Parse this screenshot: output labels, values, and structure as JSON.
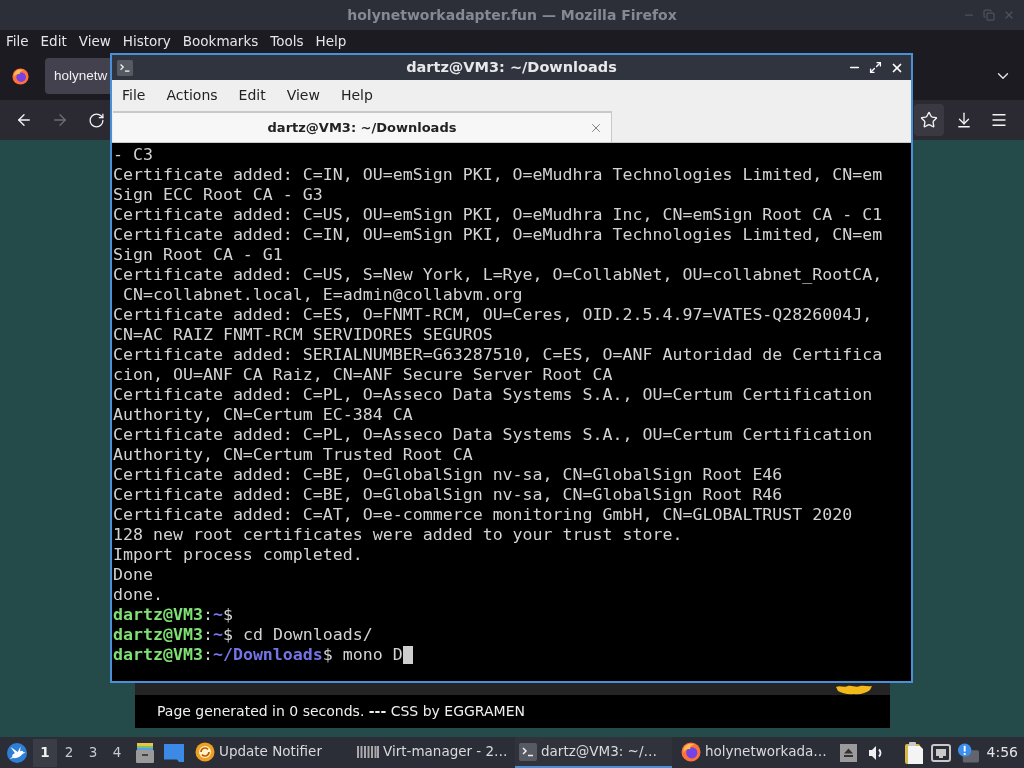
{
  "firefox": {
    "title": "holynetworkadapter.fun — Mozilla Firefox",
    "menu": [
      "File",
      "Edit",
      "View",
      "History",
      "Bookmarks",
      "Tools",
      "Help"
    ],
    "tabs": [
      {
        "label": "holynetw",
        "selected": true
      }
    ],
    "nav_buttons": [
      {
        "kind": "back",
        "disabled": false
      },
      {
        "kind": "forward",
        "disabled": true
      },
      {
        "kind": "reload",
        "disabled": false
      }
    ],
    "toolbar_buttons": [
      {
        "kind": "bookmark",
        "highlighted": true
      },
      {
        "kind": "downloads",
        "highlighted": false
      },
      {
        "kind": "menu",
        "highlighted": false
      }
    ],
    "page": {
      "footer": "Page generated in 0 seconds. **---** CSS by EGGRAMEN"
    }
  },
  "terminal": {
    "title": "dartz@VM3: ~/Downloads",
    "menu": [
      "File",
      "Actions",
      "Edit",
      "View",
      "Help"
    ],
    "tabs": [
      {
        "label": "dartz@VM3: ~/Downloads",
        "selected": true
      }
    ],
    "lines": [
      {
        "kind": "output",
        "text": "- C3"
      },
      {
        "kind": "output",
        "text": "Certificate added: C=IN, OU=emSign PKI, O=eMudhra Technologies Limited, CN=em"
      },
      {
        "kind": "output",
        "text": "Sign ECC Root CA - G3"
      },
      {
        "kind": "output",
        "text": "Certificate added: C=US, OU=emSign PKI, O=eMudhra Inc, CN=emSign Root CA - C1"
      },
      {
        "kind": "output",
        "text": "Certificate added: C=IN, OU=emSign PKI, O=eMudhra Technologies Limited, CN=em"
      },
      {
        "kind": "output",
        "text": "Sign Root CA - G1"
      },
      {
        "kind": "output",
        "text": "Certificate added: C=US, S=New York, L=Rye, O=CollabNet, OU=collabnet_RootCA,"
      },
      {
        "kind": "output",
        "text": " CN=collabnet.local, E=admin@collabvm.org"
      },
      {
        "kind": "output",
        "text": "Certificate added: C=ES, O=FNMT-RCM, OU=Ceres, OID.2.5.4.97=VATES-Q2826004J,"
      },
      {
        "kind": "output",
        "text": "CN=AC RAIZ FNMT-RCM SERVIDORES SEGUROS"
      },
      {
        "kind": "output",
        "text": "Certificate added: SERIALNUMBER=G63287510, C=ES, O=ANF Autoridad de Certifica"
      },
      {
        "kind": "output",
        "text": "cion, OU=ANF CA Raiz, CN=ANF Secure Server Root CA"
      },
      {
        "kind": "output",
        "text": "Certificate added: C=PL, O=Asseco Data Systems S.A., OU=Certum Certification"
      },
      {
        "kind": "output",
        "text": "Authority, CN=Certum EC-384 CA"
      },
      {
        "kind": "output",
        "text": "Certificate added: C=PL, O=Asseco Data Systems S.A., OU=Certum Certification"
      },
      {
        "kind": "output",
        "text": "Authority, CN=Certum Trusted Root CA"
      },
      {
        "kind": "output",
        "text": "Certificate added: C=BE, O=GlobalSign nv-sa, CN=GlobalSign Root E46"
      },
      {
        "kind": "output",
        "text": "Certificate added: C=BE, O=GlobalSign nv-sa, CN=GlobalSign Root R46"
      },
      {
        "kind": "output",
        "text": "Certificate added: C=AT, O=e-commerce monitoring GmbH, CN=GLOBALTRUST 2020"
      },
      {
        "kind": "output",
        "text": "128 new root certificates were added to your trust store."
      },
      {
        "kind": "output",
        "text": "Import process completed."
      },
      {
        "kind": "output",
        "text": "Done"
      },
      {
        "kind": "output",
        "text": "done."
      },
      {
        "kind": "prompt",
        "user": "dartz@VM3",
        "colon": ":",
        "path": "~",
        "sign": "$",
        "cursor": false
      },
      {
        "kind": "prompt",
        "user": "dartz@VM3",
        "colon": ":",
        "path": "~",
        "sign": "$",
        "command": "cd Downloads/",
        "cursor": false
      },
      {
        "kind": "prompt",
        "user": "dartz@VM3",
        "colon": ":",
        "path": "~/Downloads",
        "sign": "$",
        "command": "mono D",
        "cursor": true
      }
    ]
  },
  "taskbar": {
    "workspaces": [
      {
        "label": "1",
        "selected": true
      },
      {
        "label": "2",
        "selected": false
      },
      {
        "label": "3",
        "selected": false
      },
      {
        "label": "4",
        "selected": false
      }
    ],
    "tasks": [
      {
        "kind": "updates",
        "label": "Update Notifier",
        "selected": false
      },
      {
        "kind": "virt-manager",
        "label": "Virt-manager - 2…",
        "selected": false
      },
      {
        "kind": "terminal",
        "label": "dartz@VM3: ~/…",
        "selected": true
      },
      {
        "kind": "browser",
        "label": "holynetworkada…",
        "selected": false
      }
    ],
    "clock": "4:56"
  }
}
